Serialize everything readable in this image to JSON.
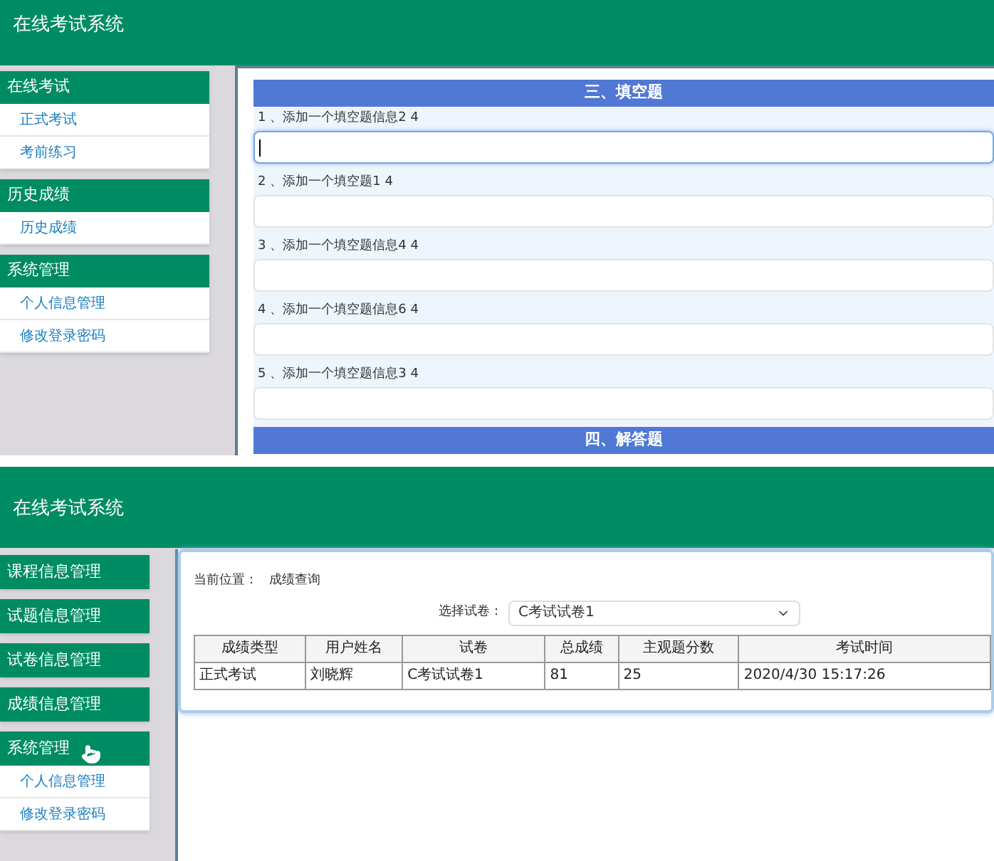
{
  "screens": [
    {
      "kind": "quiz",
      "title": "在线考试系统",
      "sidebar": [
        {
          "title": "在线考试",
          "items": [
            "正式考试",
            "考前练习"
          ]
        },
        {
          "title": "历史成绩",
          "items": [
            "历史成绩"
          ]
        },
        {
          "title": "系统管理",
          "items": [
            "个人信息管理",
            "修改登录密码"
          ]
        }
      ],
      "sections": [
        {
          "title": "三、填空题",
          "questions": [
            {
              "number": "1",
              "text": "、添加一个填空题信息2 4",
              "focused": true
            },
            {
              "number": "2",
              "text": "、添加一个填空题1 4",
              "focused": false
            },
            {
              "number": "3",
              "text": "、添加一个填空题信息4 4",
              "focused": false
            },
            {
              "number": "4",
              "text": "、添加一个填空题信息6 4",
              "focused": false
            },
            {
              "number": "5",
              "text": "、添加一个填空题信息3 4",
              "focused": false
            }
          ]
        },
        {
          "title": "四、解答题"
        }
      ]
    },
    {
      "kind": "results",
      "title": "在线考试系统",
      "sidebar": [
        {
          "title": "课程信息管理",
          "hovered": false
        },
        {
          "title": "试题信息管理",
          "hovered": false
        },
        {
          "title": "试卷信息管理",
          "hovered": false
        },
        {
          "title": "成绩信息管理",
          "hovered": false
        },
        {
          "title": "系统管理",
          "items": [
            "个人信息管理",
            "修改登录密码"
          ],
          "hovered": true
        }
      ],
      "breadcrumb_label": "当前位置：",
      "breadcrumb": "成绩查询",
      "select_label": "选择试卷：",
      "select_value": "C考试试卷1",
      "table": {
        "columns": [
          "成绩类型",
          "用户姓名",
          "试卷",
          "总成绩",
          "主观题分数",
          "考试时间"
        ],
        "rows": [
          [
            "正式考试",
            "刘晓辉",
            "C考试试卷1",
            "81",
            "25",
            "2020/4/30 15:17:26"
          ]
        ]
      }
    }
  ]
}
